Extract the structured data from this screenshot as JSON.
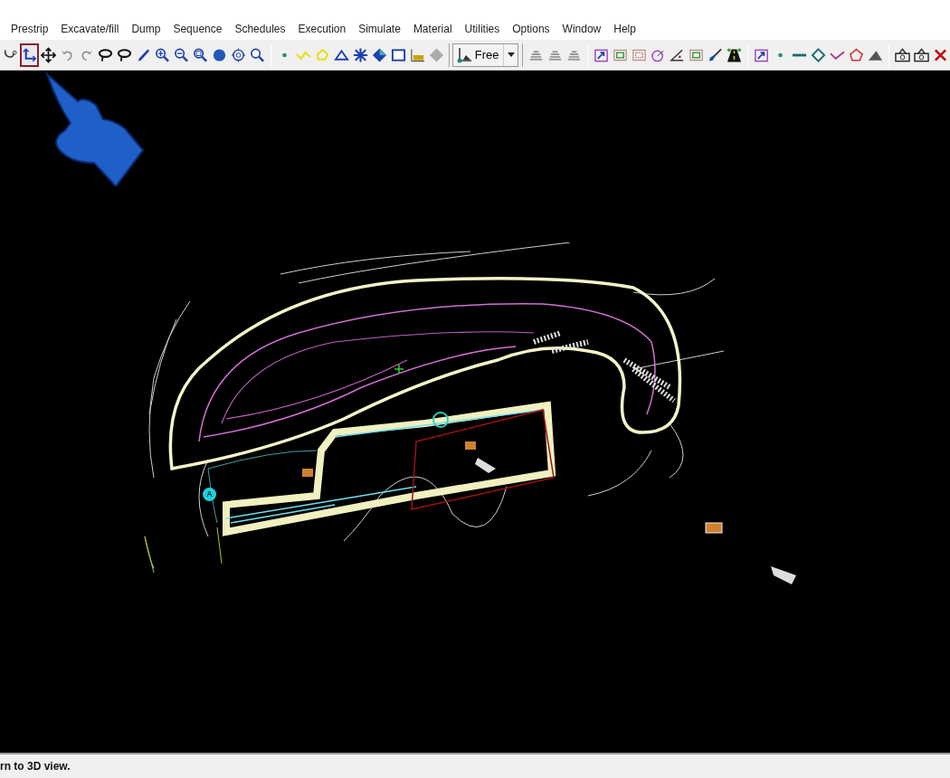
{
  "menu": [
    "Prestrip",
    "Excavate/fill",
    "Dump",
    "Sequence",
    "Schedules",
    "Execution",
    "Simulate",
    "Material",
    "Utilities",
    "Options",
    "Window",
    "Help"
  ],
  "toolbar": [
    {
      "kind": "probe",
      "selected": false
    },
    {
      "kind": "axis",
      "selected": true
    },
    {
      "kind": "move",
      "selected": false
    },
    {
      "kind": "undo",
      "selected": false
    },
    {
      "kind": "redo",
      "selected": false
    },
    {
      "kind": "lasso",
      "selected": false
    },
    {
      "kind": "lasso",
      "selected": false
    },
    {
      "kind": "pencil",
      "selected": false
    },
    {
      "kind": "zoom-in",
      "selected": false
    },
    {
      "kind": "zoom-out",
      "selected": false
    },
    {
      "kind": "zoom-box",
      "selected": false
    },
    {
      "kind": "globe",
      "selected": false
    },
    {
      "kind": "target",
      "selected": false
    },
    {
      "kind": "zoom-back",
      "selected": false
    },
    {
      "kind": "separator"
    },
    {
      "kind": "dot",
      "selected": false
    },
    {
      "kind": "polyline",
      "selected": false
    },
    {
      "kind": "polygon",
      "selected": false
    },
    {
      "kind": "triangle",
      "selected": false
    },
    {
      "kind": "mesh",
      "selected": false
    },
    {
      "kind": "diamond",
      "selected": false
    },
    {
      "kind": "window",
      "selected": false
    },
    {
      "kind": "chart",
      "selected": false
    },
    {
      "kind": "diamond-solid",
      "selected": false
    }
  ],
  "view_mode": {
    "value": "Free"
  },
  "toolbar_right": [
    {
      "kind": "layers",
      "selected": false
    },
    {
      "kind": "layers",
      "selected": false
    },
    {
      "kind": "layers",
      "selected": false
    },
    {
      "kind": "separator"
    },
    {
      "kind": "frame-arrow",
      "selected": false
    },
    {
      "kind": "frame-inner",
      "selected": false
    },
    {
      "kind": "frame-dashed",
      "selected": false
    },
    {
      "kind": "circle-tool",
      "selected": false
    },
    {
      "kind": "angle",
      "selected": false
    },
    {
      "kind": "frame-inner",
      "selected": false
    },
    {
      "kind": "shovel",
      "selected": false
    },
    {
      "kind": "road",
      "selected": false
    },
    {
      "kind": "separator"
    },
    {
      "kind": "frame-arrow",
      "selected": false
    },
    {
      "kind": "dot",
      "selected": false
    },
    {
      "kind": "line",
      "selected": false
    },
    {
      "kind": "diamond-outline",
      "selected": false
    },
    {
      "kind": "vee",
      "selected": false
    },
    {
      "kind": "pentagon",
      "selected": false
    },
    {
      "kind": "pile",
      "selected": false
    },
    {
      "kind": "separator"
    },
    {
      "kind": "camera",
      "selected": false
    },
    {
      "kind": "camera",
      "selected": false
    },
    {
      "kind": "close",
      "selected": false
    }
  ],
  "canvas": {
    "marker_label": "A"
  },
  "status_bar": {
    "text": "rn to 3D view."
  }
}
